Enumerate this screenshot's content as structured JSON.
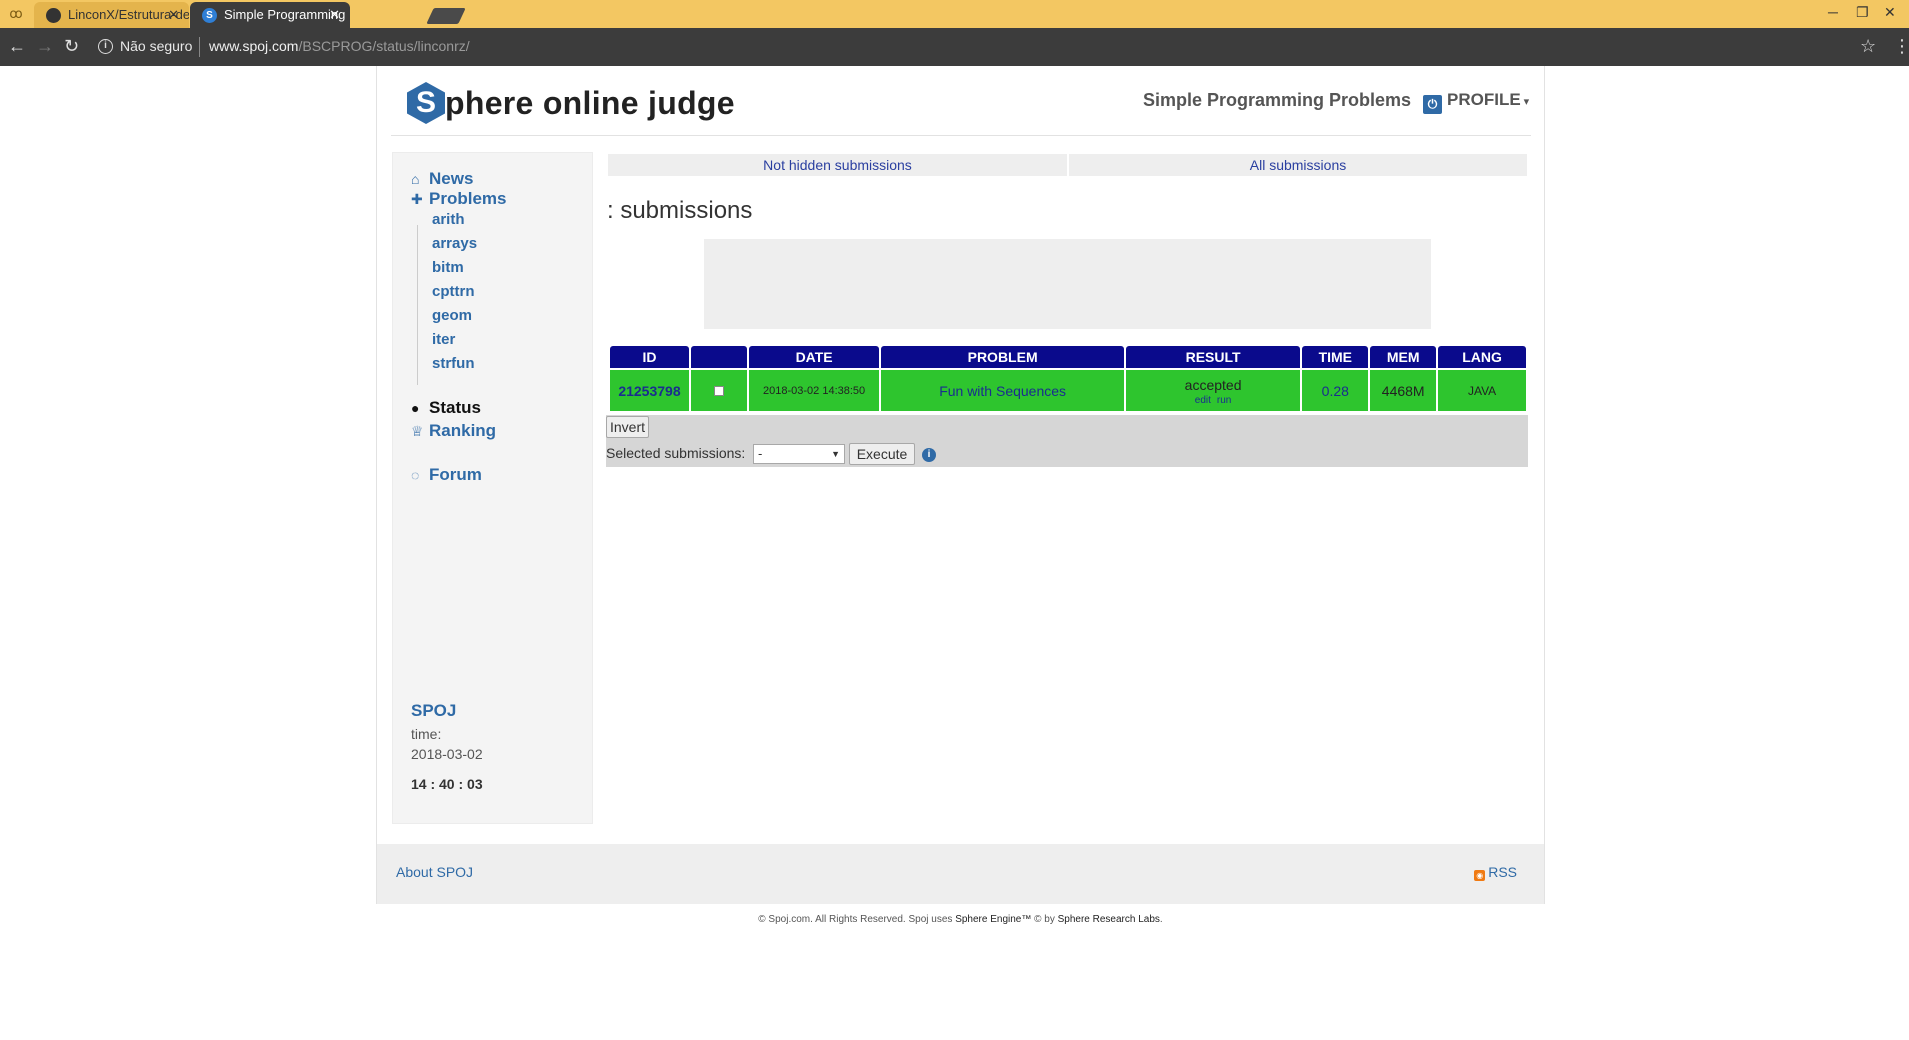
{
  "browser": {
    "tabs": [
      {
        "title": "LinconX/Estrutura-de-Da",
        "active": false
      },
      {
        "title": "Simple Programming Pro",
        "active": true
      }
    ],
    "security_text": "Não seguro",
    "url_host": "www.spoj.com",
    "url_path": "/BSCPROG/status/linconrz/",
    "icons": [
      "back-icon",
      "forward-icon",
      "reload-icon",
      "info-icon",
      "star-icon",
      "kebab-menu-icon"
    ]
  },
  "header": {
    "logo_letter": "S",
    "logo_rest": "phere online judge",
    "contest_title": "Simple Programming Problems",
    "profile_label": "PROFILE"
  },
  "sidebar": {
    "news": "News",
    "problems": "Problems",
    "subitems": [
      "arith",
      "arrays",
      "bitm",
      "cpttrn",
      "geom",
      "iter",
      "strfun"
    ],
    "status": "Status",
    "ranking": "Ranking",
    "forum": "Forum",
    "foot_title": "SPOJ",
    "foot_time_label": "time:",
    "foot_date": "2018-03-02",
    "foot_clock": "14 : 40 : 03"
  },
  "main": {
    "filter_tabs": [
      "Not hidden submissions",
      "All submissions"
    ],
    "title": ": submissions",
    "table": {
      "headers": [
        "ID",
        "",
        "DATE",
        "PROBLEM",
        "RESULT",
        "TIME",
        "MEM",
        "LANG"
      ],
      "rows": [
        {
          "id": "21253798",
          "date": "2018-03-02 14:38:50",
          "problem": "Fun with Sequences",
          "result": "accepted",
          "result_link_edit": "edit",
          "result_link_run": "run",
          "time": "0.28",
          "mem": "4468M",
          "lang": "JAVA"
        }
      ]
    },
    "invert_label": "Invert",
    "selected_label": "Selected submissions:",
    "select_value": "-",
    "execute_label": "Execute"
  },
  "footer": {
    "about": "About SPOJ",
    "rss": "RSS",
    "copyright_a": "© Spoj.com. All Rights Reserved. Spoj uses ",
    "copyright_link1": "Sphere Engine™",
    "copyright_b": " © by ",
    "copyright_link2": "Sphere Research Labs",
    "copyright_c": "."
  },
  "colors": {
    "accepted_green": "#2ec52e",
    "header_navy": "#0a0a8c",
    "link_blue": "#2f6aa6",
    "tabbar_yellow": "#f3c762"
  }
}
